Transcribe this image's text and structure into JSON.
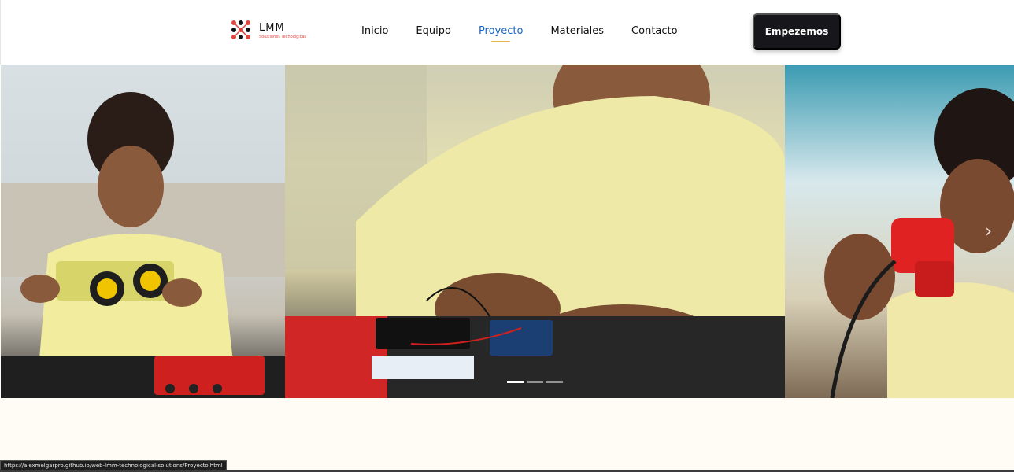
{
  "brand": {
    "name": "LMM",
    "tagline": "Soluciones Tecnológicas",
    "logo_colors": [
      "#e0463f",
      "#111111"
    ]
  },
  "nav": {
    "items": [
      {
        "label": "Inicio",
        "active": false
      },
      {
        "label": "Equipo",
        "active": false
      },
      {
        "label": "Proyecto",
        "active": true
      },
      {
        "label": "Materiales",
        "active": false
      },
      {
        "label": "Contacto",
        "active": false
      }
    ],
    "active_color": "#1565c8",
    "underline_color": "#e9b64a"
  },
  "cta": {
    "label": "Empezemos",
    "background": "#16161b"
  },
  "carousel": {
    "slides": [
      {
        "icon": "photo-boy-robot-car"
      },
      {
        "icon": "photo-boy-wiring-circuit"
      },
      {
        "icon": "photo-boy-smiling-red-part"
      }
    ],
    "indicator_count": 3,
    "active_index": 0,
    "next_icon": "chevron-right-icon",
    "next_glyph": "›"
  },
  "status_bar": {
    "url": "https://alexmelgarpro.github.io/web-lmm-technological-solutions/Proyecto.html"
  }
}
